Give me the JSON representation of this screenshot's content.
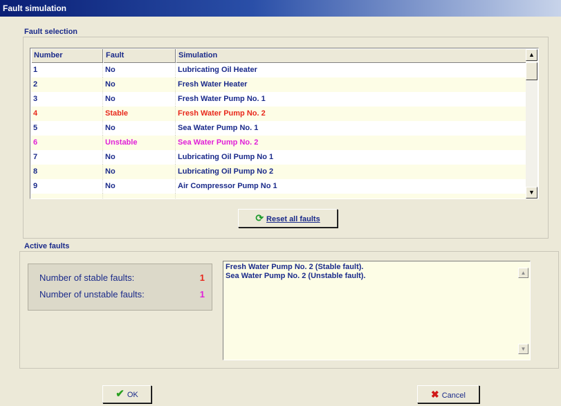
{
  "window": {
    "title": "Fault simulation"
  },
  "fault_selection": {
    "label": "Fault selection",
    "columns": [
      "Number",
      "Fault",
      "Simulation"
    ],
    "rows": [
      {
        "number": "1",
        "fault": "No",
        "simulation": "Lubricating Oil Heater",
        "kind": "normal"
      },
      {
        "number": "2",
        "fault": "No",
        "simulation": "Fresh Water Heater",
        "kind": "normal"
      },
      {
        "number": "3",
        "fault": "No",
        "simulation": "Fresh Water Pump No. 1",
        "kind": "normal"
      },
      {
        "number": "4",
        "fault": "Stable",
        "simulation": "Fresh Water Pump No. 2",
        "kind": "stable"
      },
      {
        "number": "5",
        "fault": "No",
        "simulation": "Sea Water Pump No. 1",
        "kind": "normal"
      },
      {
        "number": "6",
        "fault": "Unstable",
        "simulation": "Sea Water Pump No. 2",
        "kind": "unstable"
      },
      {
        "number": "7",
        "fault": "No",
        "simulation": "Lubricating Oil Pump No 1",
        "kind": "normal"
      },
      {
        "number": "8",
        "fault": "No",
        "simulation": "Lubricating Oil Pump No 2",
        "kind": "normal"
      },
      {
        "number": "9",
        "fault": "No",
        "simulation": "Air Compressor Pump No 1",
        "kind": "normal"
      },
      {
        "number": "",
        "fault": "",
        "simulation": "",
        "kind": "normal"
      }
    ],
    "reset_button": "Reset all faults"
  },
  "active_faults": {
    "label": "Active faults",
    "stable_label": "Number of stable faults:",
    "stable_count": "1",
    "unstable_label": "Number of unstable faults:",
    "unstable_count": "1",
    "list": [
      "Fresh Water Pump No. 2 (Stable fault).",
      "Sea Water Pump No. 2 (Unstable fault)."
    ]
  },
  "buttons": {
    "ok": "OK",
    "cancel": "Cancel"
  },
  "colors": {
    "stable": "#e8281c",
    "unstable": "#e020d8",
    "text": "#1a2a8a",
    "title_bar": "#0a1f75"
  },
  "icons": {
    "reset": "refresh-icon",
    "ok": "checkmark-icon",
    "cancel": "x-icon"
  }
}
